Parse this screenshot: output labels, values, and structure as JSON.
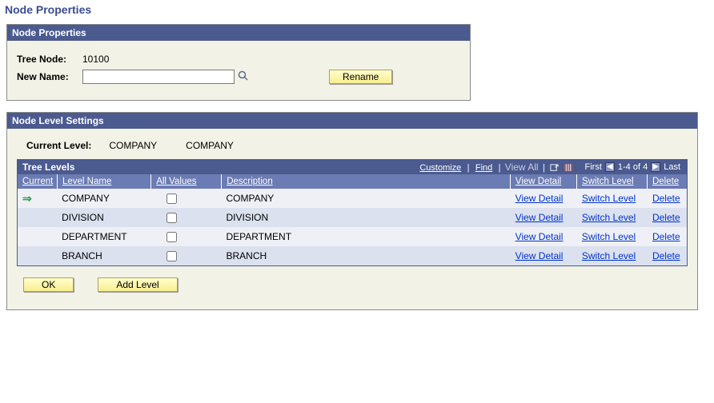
{
  "page_title": "Node Properties",
  "panel1": {
    "title": "Node Properties",
    "tree_node_label": "Tree Node:",
    "tree_node_value": "10100",
    "new_name_label": "New Name:",
    "new_name_value": "",
    "rename_btn": "Rename"
  },
  "panel2": {
    "title": "Node Level Settings",
    "current_level_label": "Current Level:",
    "current_level_code": "COMPANY",
    "current_level_desc": "COMPANY",
    "grid_title": "Tree Levels",
    "grid_nav": {
      "customize": "Customize",
      "find": "Find",
      "viewall": "View All",
      "first": "First",
      "range": "1-4 of 4",
      "last": "Last"
    },
    "columns": {
      "current": "Current",
      "level_name": "Level Name",
      "all_values": "All Values",
      "description": "Description",
      "view_detail": "View Detail",
      "switch_level": "Switch Level",
      "delete": "Delete"
    },
    "rows": [
      {
        "current": true,
        "level_name": "COMPANY",
        "all_values": false,
        "description": "COMPANY",
        "view": "View Detail",
        "switch": "Switch Level",
        "del": "Delete"
      },
      {
        "current": false,
        "level_name": "DIVISION",
        "all_values": false,
        "description": "DIVISION",
        "view": "View Detail",
        "switch": "Switch Level",
        "del": "Delete"
      },
      {
        "current": false,
        "level_name": "DEPARTMENT",
        "all_values": false,
        "description": "DEPARTMENT",
        "view": "View Detail",
        "switch": "Switch Level",
        "del": "Delete"
      },
      {
        "current": false,
        "level_name": "BRANCH",
        "all_values": false,
        "description": "BRANCH",
        "view": "View Detail",
        "switch": "Switch Level",
        "del": "Delete"
      }
    ],
    "ok_btn": "OK",
    "add_level_btn": "Add Level"
  }
}
